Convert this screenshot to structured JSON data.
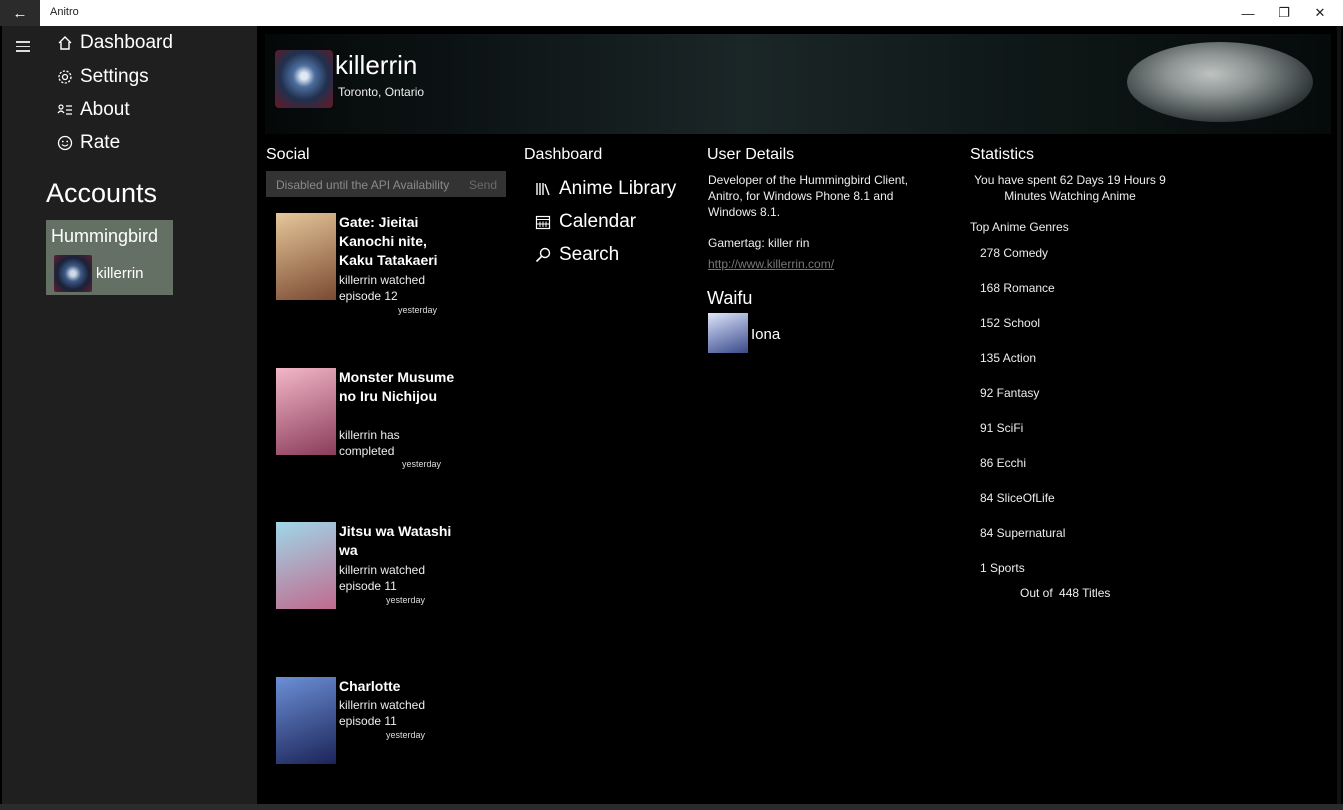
{
  "window": {
    "title": "Anitro",
    "back_icon": "arrow-left-icon",
    "min": "—",
    "max": "❐",
    "close": "✕"
  },
  "nav": {
    "items": [
      {
        "label": "Dashboard",
        "icon": "home-icon"
      },
      {
        "label": "Settings",
        "icon": "gear-icon"
      },
      {
        "label": "About",
        "icon": "person-list-icon"
      },
      {
        "label": "Rate",
        "icon": "smiley-icon"
      }
    ],
    "accounts_heading": "Accounts",
    "account": {
      "service": "Hummingbird",
      "username": "killerrin"
    }
  },
  "profile": {
    "name": "killerrin",
    "location": "Toronto, Ontario"
  },
  "social": {
    "heading": "Social",
    "post_placeholder": "Disabled until the API Availability",
    "send_label": "Send",
    "feed": [
      {
        "title": "Gate: Jieitai Kanochi nite, Kaku Tatakaeri",
        "action": "killerrin watched episode 12",
        "time": "yesterday",
        "cover_colors": [
          "#e6c79a",
          "#7a4a32"
        ]
      },
      {
        "title": "Monster Musume no Iru Nichijou",
        "action": "killerrin has completed",
        "time": "yesterday",
        "cover_colors": [
          "#f2b7c8",
          "#8a3c5a"
        ]
      },
      {
        "title": "Jitsu wa Watashi wa",
        "action": "killerrin watched episode 11",
        "time": "yesterday",
        "cover_colors": [
          "#9fd7e8",
          "#c06a8e"
        ]
      },
      {
        "title": "Charlotte",
        "action": "killerrin watched episode 11",
        "time": "yesterday",
        "cover_colors": [
          "#6c8fd6",
          "#1b2458"
        ]
      }
    ]
  },
  "dashboard": {
    "heading": "Dashboard",
    "links": [
      {
        "label": "Anime Library",
        "icon": "library-icon"
      },
      {
        "label": "Calendar",
        "icon": "calendar-icon"
      },
      {
        "label": "Search",
        "icon": "search-icon"
      }
    ]
  },
  "user_details": {
    "heading": "User Details",
    "bio": "Developer of the Hummingbird Client, Anitro, for Windows Phone 8.1 and Windows 8.1.",
    "gamertag": "Gamertag: killer rin",
    "website": "http://www.killerrin.com/",
    "waifu_heading": "Waifu",
    "waifu_name": "Iona"
  },
  "statistics": {
    "heading": "Statistics",
    "time_spent": "You have spent  62 Days 19 Hours 9 Minutes Watching Anime",
    "top_genres_heading": "Top Anime Genres",
    "genres": [
      "278 Comedy",
      "168 Romance",
      "152 School",
      "135 Action",
      "92 Fantasy",
      "91 SciFi",
      "86 Ecchi",
      "84 SliceOfLife",
      "84 Supernatural",
      "1 Sports"
    ],
    "out_of_label": "Out of",
    "total_titles": "448 Titles"
  }
}
